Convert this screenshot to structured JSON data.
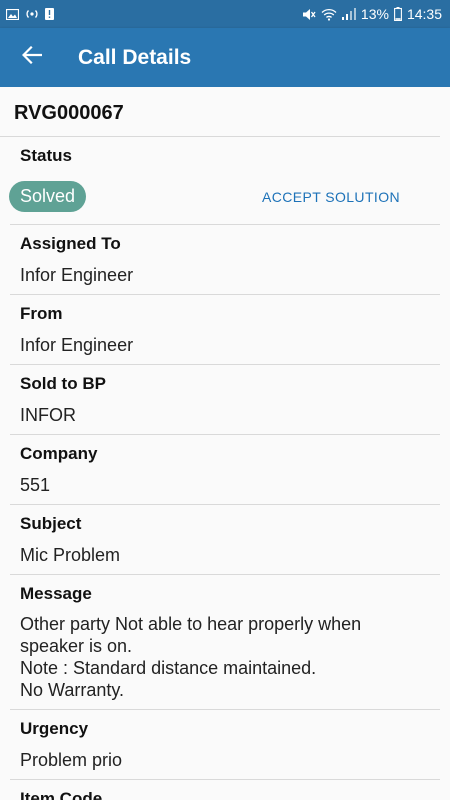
{
  "status_bar": {
    "battery": "13%",
    "time": "14:35",
    "icons": [
      "image-icon",
      "wifi-hotspot-icon",
      "alert-icon",
      "mute-icon",
      "wifi-icon",
      "signal-icon",
      "battery-icon"
    ]
  },
  "app_bar": {
    "title": "Call Details",
    "back_icon": "arrow-left-icon",
    "color": "#2a77b2"
  },
  "call": {
    "id": "RVG000067",
    "status_label": "Status",
    "status_value": "Solved",
    "accept_label": "ACCEPT SOLUTION",
    "status_color": "#5fa295",
    "fields": [
      {
        "label": "Assigned To",
        "value": "Infor Engineer"
      },
      {
        "label": "From",
        "value": "Infor Engineer"
      },
      {
        "label": "Sold to BP",
        "value": "INFOR"
      },
      {
        "label": "Company",
        "value": "551"
      },
      {
        "label": "Subject",
        "value": "Mic Problem"
      },
      {
        "label": "Message",
        "value": "Other party Not able to hear properly when speaker is on.\nNote : Standard distance maintained.\nNo Warranty."
      },
      {
        "label": "Urgency",
        "value": "Problem prio"
      },
      {
        "label": "Item Code",
        "value": ""
      }
    ]
  }
}
